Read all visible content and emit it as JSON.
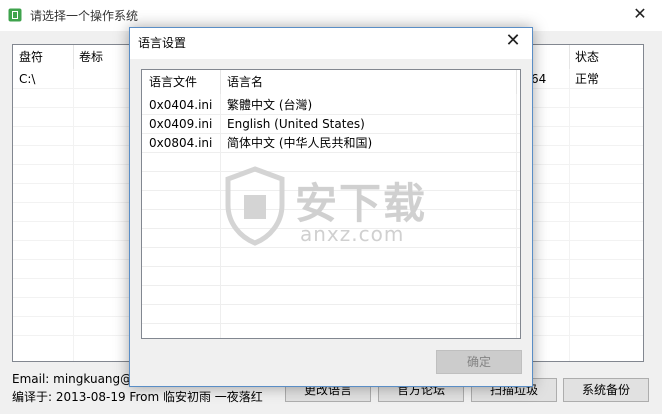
{
  "window": {
    "title": "请选择一个操作系统",
    "close_glyph": "✕"
  },
  "main_list": {
    "columns": [
      "盘符",
      "卷标",
      "状态"
    ],
    "row": {
      "drive": "C:\\",
      "partial": "64",
      "status": "正常"
    }
  },
  "footer": {
    "email": "Email: mingkuang@li",
    "compiled": "编译于: 2013-08-19 From 临安初雨 一夜落红"
  },
  "buttons": {
    "change_language": "更改语言",
    "official_forum": "官方论坛",
    "scan_junk": "扫描垃圾",
    "system_backup": "系统备份"
  },
  "dialog": {
    "title": "语言设置",
    "close_glyph": "✕",
    "columns": [
      "语言文件",
      "语言名"
    ],
    "rows": [
      {
        "file": "0x0404.ini",
        "name": "繁體中文 (台灣)"
      },
      {
        "file": "0x0409.ini",
        "name": "English (United States)"
      },
      {
        "file": "0x0804.ini",
        "name": "简体中文 (中华人民共和国)"
      }
    ],
    "ok_label": "确定"
  },
  "watermark": {
    "cn": "安下载",
    "en": "anxz.com"
  },
  "colors": {
    "titlebar": "#ffffff",
    "body": "#f0f0f0",
    "dialog_border": "#5a8ec6",
    "icon_green": "#3fa34d"
  }
}
